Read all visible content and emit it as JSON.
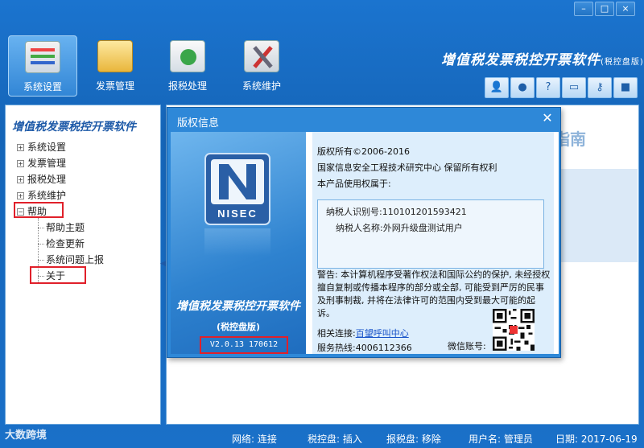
{
  "window": {
    "controls": [
      "–",
      "□",
      "×"
    ]
  },
  "toolbar": {
    "items": [
      {
        "label": "系统设置",
        "icon": "settings-panel-icon"
      },
      {
        "label": "发票管理",
        "icon": "folder-icon"
      },
      {
        "label": "报税处理",
        "icon": "tax-report-icon"
      },
      {
        "label": "系统维护",
        "icon": "tools-icon"
      }
    ],
    "active_index": 0
  },
  "app_title": {
    "main": "增值税发票税控开票软件",
    "edition": "(税控盘版)"
  },
  "mini_icons": [
    "user-icon",
    "globe-icon",
    "help-icon",
    "window-icon",
    "key-icon",
    "lock-icon"
  ],
  "left_panel": {
    "title": "增值税发票税控开票软件",
    "tree": [
      {
        "label": "系统设置",
        "expanded": false
      },
      {
        "label": "发票管理",
        "expanded": false
      },
      {
        "label": "报税处理",
        "expanded": false
      },
      {
        "label": "系统维护",
        "expanded": false
      },
      {
        "label": "帮助",
        "expanded": true
      }
    ],
    "help_children": [
      "帮助主题",
      "检查更新",
      "系统问题上报",
      "关于"
    ]
  },
  "background": {
    "partial_text": "指南"
  },
  "dialog": {
    "title": "版权信息",
    "close": "✕",
    "logo_text": "NISEC",
    "product_name": "增值税发票税控开票软件",
    "product_edition": "(税控盘版)",
    "version": "V2.0.13 170612",
    "copyright": "版权所有©2006-2016",
    "org": "国家信息安全工程技术研究中心  保留所有权利",
    "owner_intro": "本产品使用权属于:",
    "taxpayer_id_label": "纳税人识别号:",
    "taxpayer_id": "110101201593421",
    "taxpayer_name_label": "纳税人名称:",
    "taxpayer_name": "外网升级盘测试用户",
    "warning": "警告: 本计算机程序受著作权法和国际公约的保护, 未经授权擅自复制或传播本程序的部分或全部, 可能受到严厉的民事及刑事制裁, 并将在法律许可的范围内受到最大可能的起诉。",
    "related_label": "相关连接:",
    "related_link": "百望呼叫中心",
    "hotline_label": "服务热线:",
    "hotline": "4006112366",
    "wechat_label": "微信账号:"
  },
  "statusbar": {
    "brand": "大数跨境",
    "network": "网络: 连接",
    "tax_disk": "税控盘: 插入",
    "report_disk": "报税盘: 移除",
    "user": "用户名: 管理员",
    "date": "日期: 2017-06-19"
  }
}
